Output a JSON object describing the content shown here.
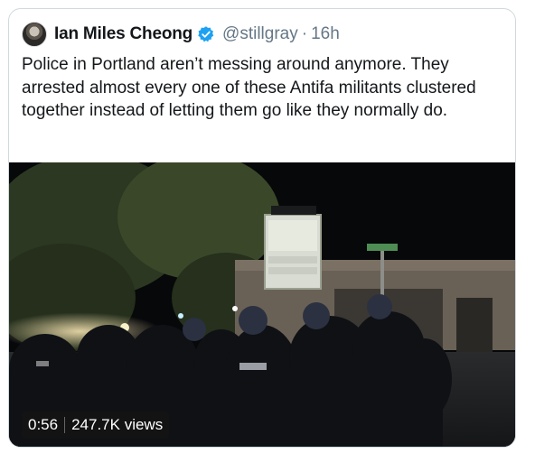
{
  "tweet": {
    "author_name": "Ian Miles Cheong",
    "handle": "@stillgray",
    "separator": "·",
    "time": "16h",
    "text": "Police in Portland aren’t messing around anymore. They arrested almost every one of these Antifa militants clustered together instead of letting them go like they normally do.",
    "verified": true
  },
  "video": {
    "duration": "0:56",
    "views": "247.7K views"
  },
  "colors": {
    "text": "#14171a",
    "muted": "#657786",
    "verified_blue": "#1da1f2",
    "border": "#cfd9de"
  },
  "icons": {
    "verified": "verified-badge-icon",
    "avatar": "avatar"
  }
}
